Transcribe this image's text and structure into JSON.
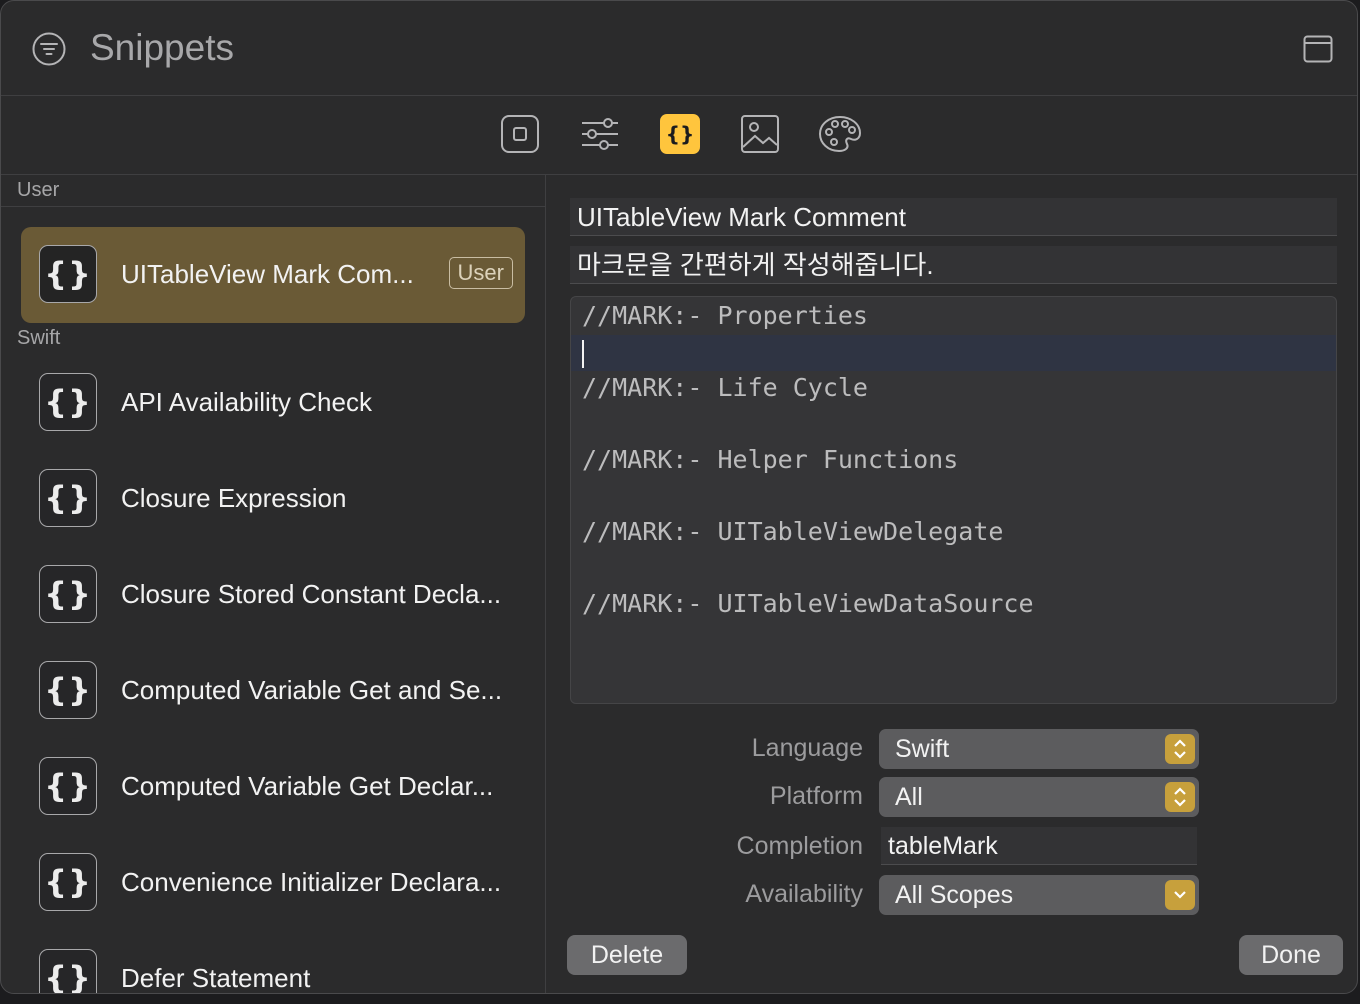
{
  "window": {
    "title": "Snippets"
  },
  "toolbar": {
    "tabs": [
      {
        "icon": "square-icon"
      },
      {
        "icon": "sliders-icon"
      },
      {
        "icon": "braces-icon",
        "active": true
      },
      {
        "icon": "image-icon"
      },
      {
        "icon": "palette-icon"
      }
    ],
    "accent": "#ffc53d"
  },
  "sidebar": {
    "user_section": "User",
    "swift_section": "Swift",
    "user_items": [
      {
        "label": "UITableView Mark Com...",
        "badge": "User",
        "selected": true
      }
    ],
    "swift_items": [
      {
        "label": "API Availability Check"
      },
      {
        "label": "Closure Expression"
      },
      {
        "label": "Closure Stored Constant Decla..."
      },
      {
        "label": "Computed Variable Get and Se..."
      },
      {
        "label": "Computed Variable Get Declar..."
      },
      {
        "label": "Convenience Initializer Declara..."
      },
      {
        "label": "Defer Statement"
      }
    ],
    "selected_color": "#6a5a36"
  },
  "detail": {
    "name": "UITableView Mark Comment",
    "summary": "마크문을 간편하게 작성해줍니다.",
    "code_lines": [
      "//MARK:- Properties",
      "",
      "//MARK:- Life Cycle",
      "",
      "//MARK:- Helper Functions",
      "",
      "//MARK:- UITableViewDelegate",
      "",
      "//MARK:- UITableViewDataSource"
    ],
    "language_label": "Language",
    "language_value": "Swift",
    "platform_label": "Platform",
    "platform_value": "All",
    "completion_label": "Completion",
    "completion_value": "tableMark",
    "availability_label": "Availability",
    "availability_value": "All Scopes",
    "delete_label": "Delete",
    "done_label": "Done"
  }
}
